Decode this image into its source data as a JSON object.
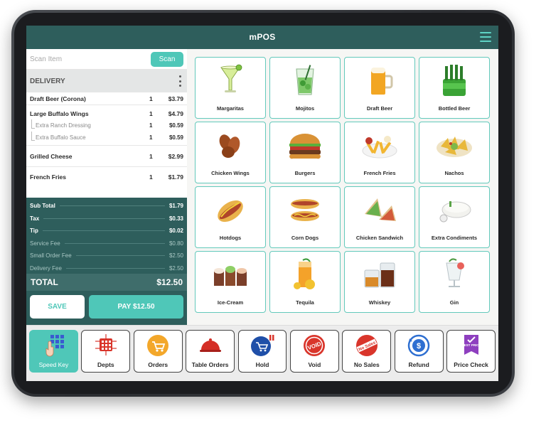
{
  "app": {
    "title": "mPOS"
  },
  "colors": {
    "header": "#2e5e5c",
    "accent": "#4fc7b8",
    "tile_border": "#63c9bb"
  },
  "scan": {
    "placeholder": "Scan Item",
    "button_label": "Scan"
  },
  "order": {
    "type_label": "DELIVERY",
    "items": [
      {
        "name": "Draft Beer (Corona)",
        "qty": "1",
        "price": "$3.79",
        "modifiers": []
      },
      {
        "name": "Large Buffalo Wings",
        "qty": "1",
        "price": "$4.79",
        "modifiers": [
          {
            "name": "Extra Ranch Dressing",
            "qty": "1",
            "price": "$0.59"
          },
          {
            "name": "Extra Buffalo Sauce",
            "qty": "1",
            "price": "$0.59"
          }
        ]
      },
      {
        "name": "Grilled Cheese",
        "qty": "1",
        "price": "$2.99",
        "modifiers": []
      },
      {
        "name": "French Fries",
        "qty": "1",
        "price": "$1.79",
        "modifiers": []
      }
    ]
  },
  "totals": {
    "sub_total_label": "Sub Total",
    "sub_total": "$1.79",
    "tax_label": "Tax",
    "tax": "$0.33",
    "tip_label": "Tip",
    "tip": "$0.02",
    "service_fee_label": "Service Fee",
    "service_fee": "$0.80",
    "small_order_fee_label": "Small Order Fee",
    "small_order_fee": "$2.50",
    "delivery_fee_label": "Delivery Fee",
    "delivery_fee": "$2.50",
    "total_label": "TOTAL",
    "total": "$12.50"
  },
  "actions": {
    "save_label": "SAVE",
    "pay_label": "PAY $12.50"
  },
  "products": [
    {
      "name": "Margaritas",
      "icon": "margarita-icon"
    },
    {
      "name": "Mojitos",
      "icon": "mojito-icon"
    },
    {
      "name": "Draft Beer",
      "icon": "beer-mug-icon"
    },
    {
      "name": "Bottled Beer",
      "icon": "beer-bottles-icon"
    },
    {
      "name": "Chicken Wings",
      "icon": "chicken-wings-icon"
    },
    {
      "name": "Burgers",
      "icon": "burger-icon"
    },
    {
      "name": "French Fries",
      "icon": "fries-icon"
    },
    {
      "name": "Nachos",
      "icon": "nachos-icon"
    },
    {
      "name": "Hotdogs",
      "icon": "hotdog-icon"
    },
    {
      "name": "Corn Dogs",
      "icon": "corn-dog-icon"
    },
    {
      "name": "Chicken Sandwich",
      "icon": "sandwich-icon"
    },
    {
      "name": "Extra Condiments",
      "icon": "condiments-icon"
    },
    {
      "name": "Ice-Cream",
      "icon": "ice-cream-icon"
    },
    {
      "name": "Tequila",
      "icon": "tequila-icon"
    },
    {
      "name": "Whiskey",
      "icon": "whiskey-icon"
    },
    {
      "name": "Gin",
      "icon": "gin-icon"
    }
  ],
  "bottom_bar": [
    {
      "label": "Speed Key",
      "icon": "speed-key-icon",
      "active": true
    },
    {
      "label": "Depts",
      "icon": "depts-icon",
      "active": false
    },
    {
      "label": "Orders",
      "icon": "orders-icon",
      "active": false
    },
    {
      "label": "Table Orders",
      "icon": "table-orders-icon",
      "active": false
    },
    {
      "label": "Hold",
      "icon": "hold-icon",
      "active": false
    },
    {
      "label": "Void",
      "icon": "void-icon",
      "active": false
    },
    {
      "label": "No Sales",
      "icon": "no-sales-icon",
      "active": false
    },
    {
      "label": "Refund",
      "icon": "refund-icon",
      "active": false
    },
    {
      "label": "Price Check",
      "icon": "price-check-icon",
      "active": false
    }
  ],
  "icon_text": {
    "void": "VOID",
    "no_sales": "No Sales",
    "best_price": "BEST PRICE"
  }
}
